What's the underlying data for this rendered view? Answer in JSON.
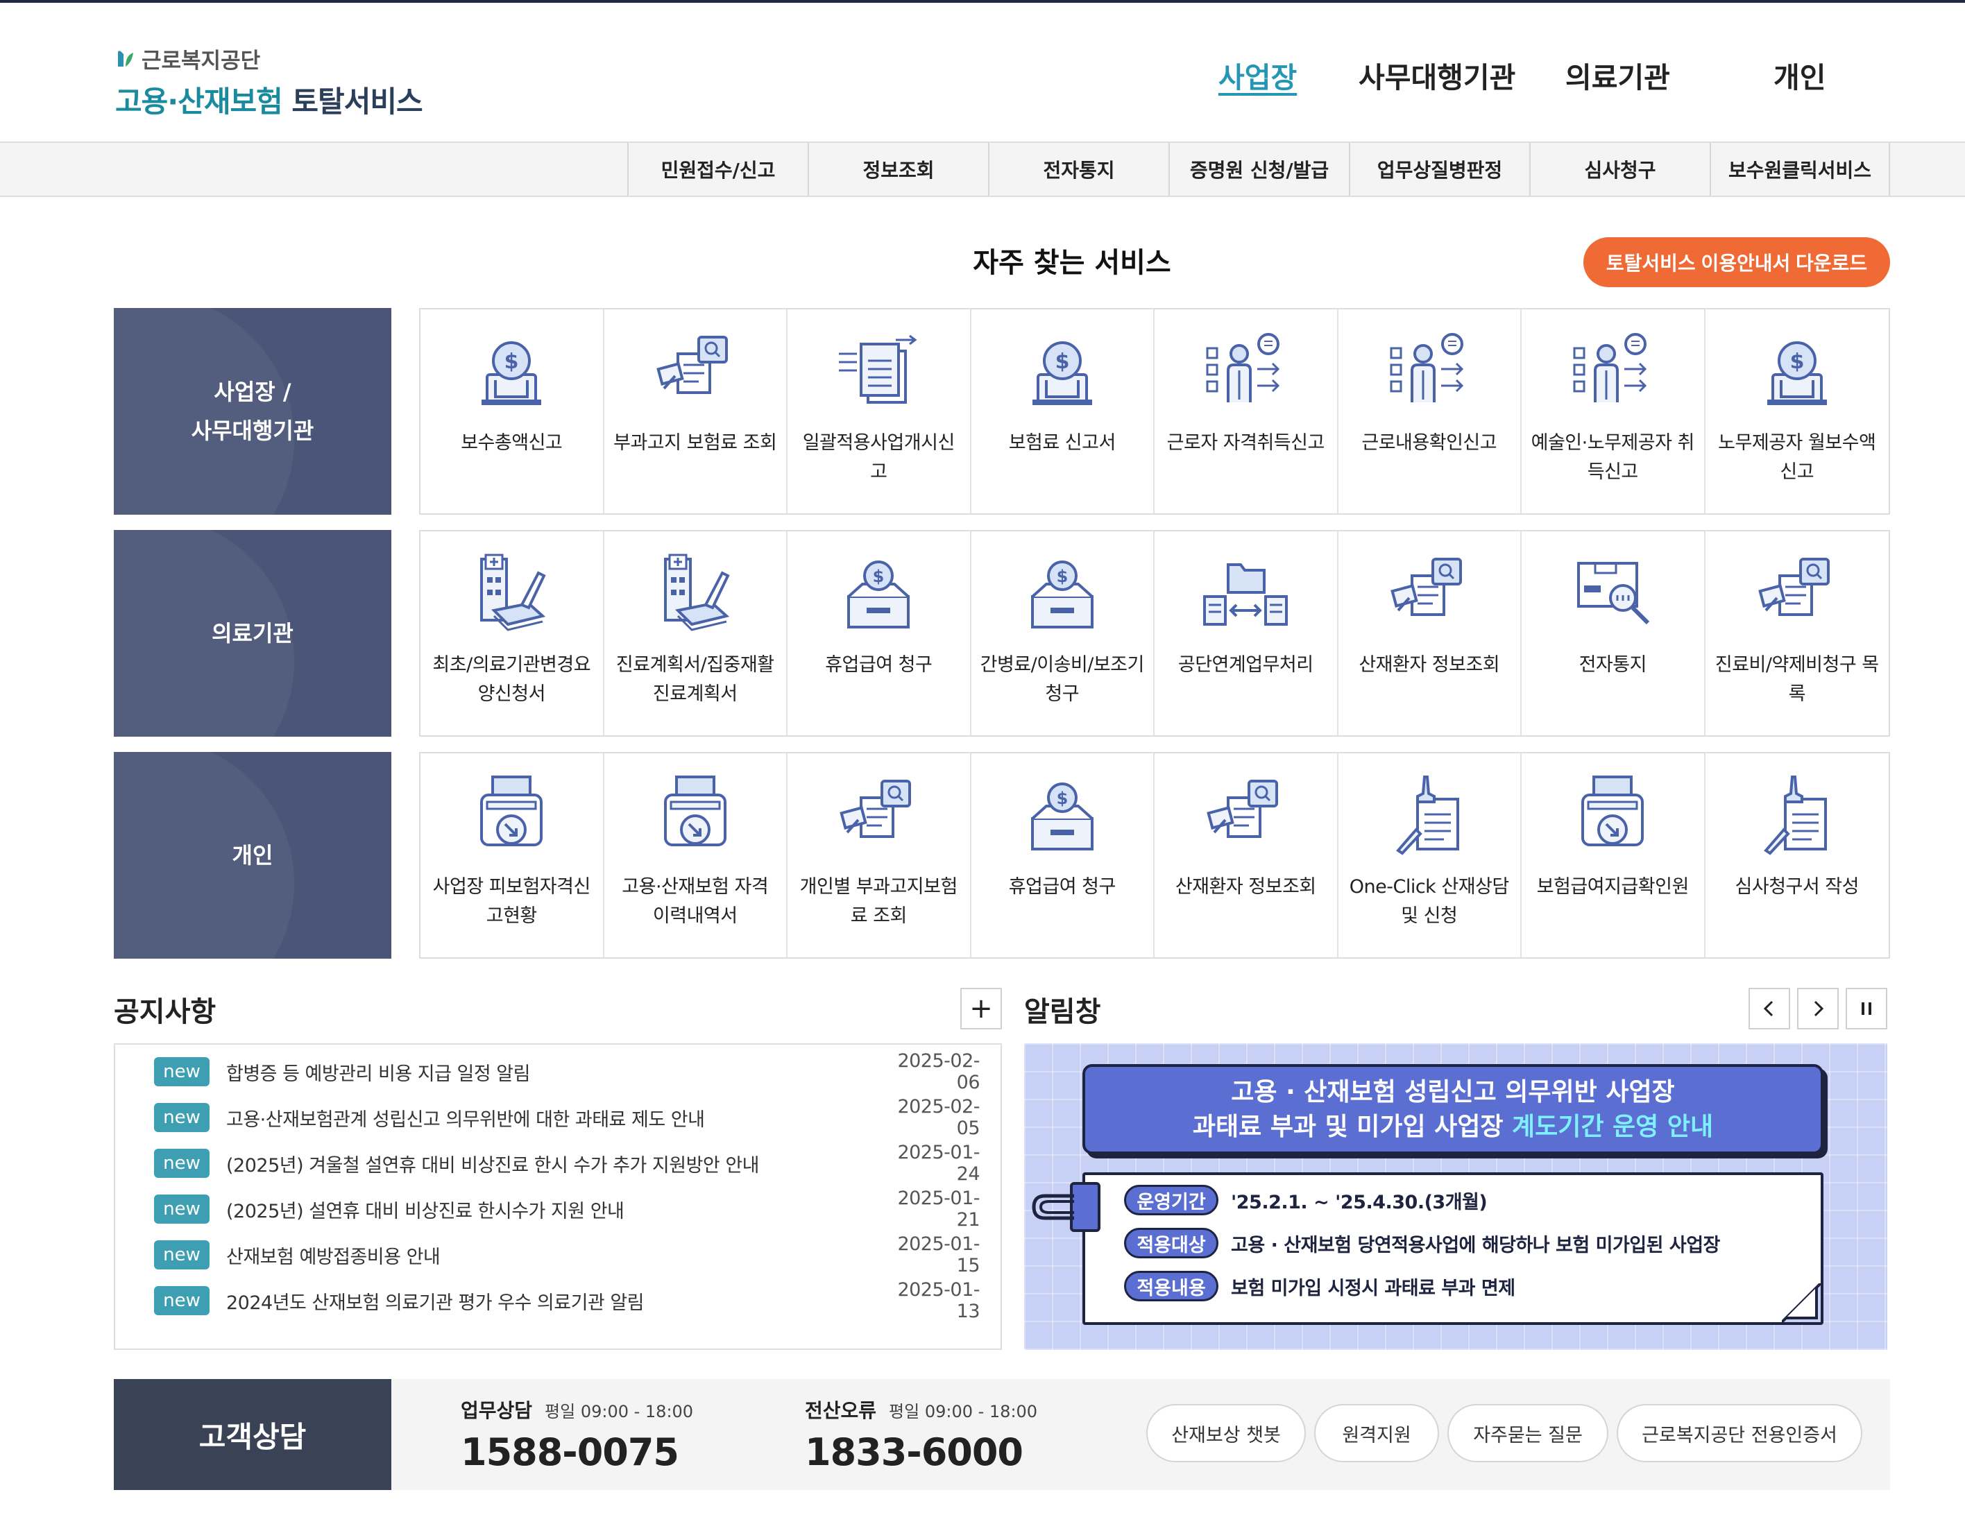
{
  "header": {
    "org_name": "근로복지공단",
    "title_part1": "고용·산재보험",
    "title_part2": "토탈서비스",
    "nav": [
      "사업장",
      "사무대행기관",
      "의료기관",
      "개인"
    ],
    "active_nav": "사업장"
  },
  "subnav": [
    "민원접수/신고",
    "정보조회",
    "전자통지",
    "증명원 신청/발급",
    "업무상질병판정",
    "심사청구",
    "보수원클릭서비스"
  ],
  "services": {
    "title": "자주 찾는 서비스",
    "download_button": "토탈서비스 이용안내서 다운로드",
    "rows": [
      {
        "label": "사업장 /\n사무대행기관",
        "items": [
          {
            "label": "보수총액신고",
            "icon": "money-bag-icon"
          },
          {
            "label": "부과고지 보험료 조회",
            "icon": "document-search-icon"
          },
          {
            "label": "일괄적용사업개시신고",
            "icon": "document-transfer-icon"
          },
          {
            "label": "보험료 신고서",
            "icon": "money-bag-icon"
          },
          {
            "label": "근로자 자격취득신고",
            "icon": "worker-report-icon"
          },
          {
            "label": "근로내용확인신고",
            "icon": "worker-report-icon"
          },
          {
            "label": "예술인·노무제공자 취득신고",
            "icon": "worker-report-icon"
          },
          {
            "label": "노무제공자 월보수액 신고",
            "icon": "money-bag-icon"
          }
        ]
      },
      {
        "label": "의료기관",
        "items": [
          {
            "label": "최초/의료기관변경요양신청서",
            "icon": "hospital-write-icon"
          },
          {
            "label": "진료계획서/집중재활 진료계획서",
            "icon": "hospital-write-icon"
          },
          {
            "label": "휴업급여 청구",
            "icon": "coin-box-icon"
          },
          {
            "label": "간병료/이송비/보조기 청구",
            "icon": "coin-box-icon"
          },
          {
            "label": "공단연계업무처리",
            "icon": "folder-exchange-icon"
          },
          {
            "label": "산재환자 정보조회",
            "icon": "document-search-icon"
          },
          {
            "label": "전자통지",
            "icon": "electronic-notice-icon"
          },
          {
            "label": "진료비/약제비청구 목록",
            "icon": "document-search-icon"
          }
        ]
      },
      {
        "label": "개인",
        "items": [
          {
            "label": "사업장 피보험자격신고현황",
            "icon": "printer-download-icon"
          },
          {
            "label": "고용·산재보험 자격 이력내역서",
            "icon": "printer-download-icon"
          },
          {
            "label": "개인별 부과고지보험료 조회",
            "icon": "document-search-icon"
          },
          {
            "label": "휴업급여 청구",
            "icon": "coin-box-icon"
          },
          {
            "label": "산재환자 정보조회",
            "icon": "document-search-icon"
          },
          {
            "label": "One-Click 산재상담 및 신청",
            "icon": "stamp-document-icon"
          },
          {
            "label": "보험급여지급확인원",
            "icon": "printer-download-icon"
          },
          {
            "label": "심사청구서 작성",
            "icon": "stamp-document-icon"
          }
        ]
      }
    ]
  },
  "notices": {
    "title": "공지사항",
    "more_button": "+",
    "badge": "new",
    "items": [
      {
        "title": "합병증 등 예방관리 비용 지급 일정 알림",
        "date": "2025-02-06"
      },
      {
        "title": "고용·산재보험관계 성립신고 의무위반에 대한 과태료 제도 안내",
        "date": "2025-02-05"
      },
      {
        "title": "(2025년) 겨울철 설연휴 대비 비상진료 한시 수가 추가 지원방안 안내",
        "date": "2025-01-24"
      },
      {
        "title": "(2025년) 설연휴 대비 비상진료 한시수가 지원 안내",
        "date": "2025-01-21"
      },
      {
        "title": "산재보험 예방접종비용 안내",
        "date": "2025-01-15"
      },
      {
        "title": "2024년도 산재보험 의료기관 평가 우수 의료기관 알림",
        "date": "2025-01-13"
      }
    ]
  },
  "alerts": {
    "title": "알림창",
    "banner": {
      "headline1": "고용 · 산재보험 성립신고 의무위반 사업장",
      "headline2a": "과태료 부과 및 미가입 사업장 ",
      "headline2b": "계도기간 운영 안내",
      "lines": [
        {
          "tag": "운영기간",
          "text": "'25.2.1. ~ '25.4.30.(3개월)"
        },
        {
          "tag": "적용대상",
          "text": "고용 · 산재보험 당연적용사업에 해당하나 보험 미가입된 사업장"
        },
        {
          "tag": "적용내용",
          "text": "보험 미가입 시정시 과태료 부과 면제"
        }
      ]
    }
  },
  "customer": {
    "label": "고객상담",
    "work": {
      "title": "업무상담",
      "hours": "평일 09:00 - 18:00",
      "phone": "1588-0075"
    },
    "error": {
      "title": "전산오류",
      "hours": "평일 09:00 - 18:00",
      "phone": "1833-6000"
    },
    "buttons": [
      "산재보상 챗봇",
      "원격지원",
      "자주묻는 질문",
      "근로복지공단 전용인증서"
    ]
  },
  "colors": {
    "accent": "#2596b3",
    "row_label": "#4a5578",
    "orange": "#f06a36",
    "badge": "#3d9fb1",
    "icon": "#4a63a8"
  }
}
